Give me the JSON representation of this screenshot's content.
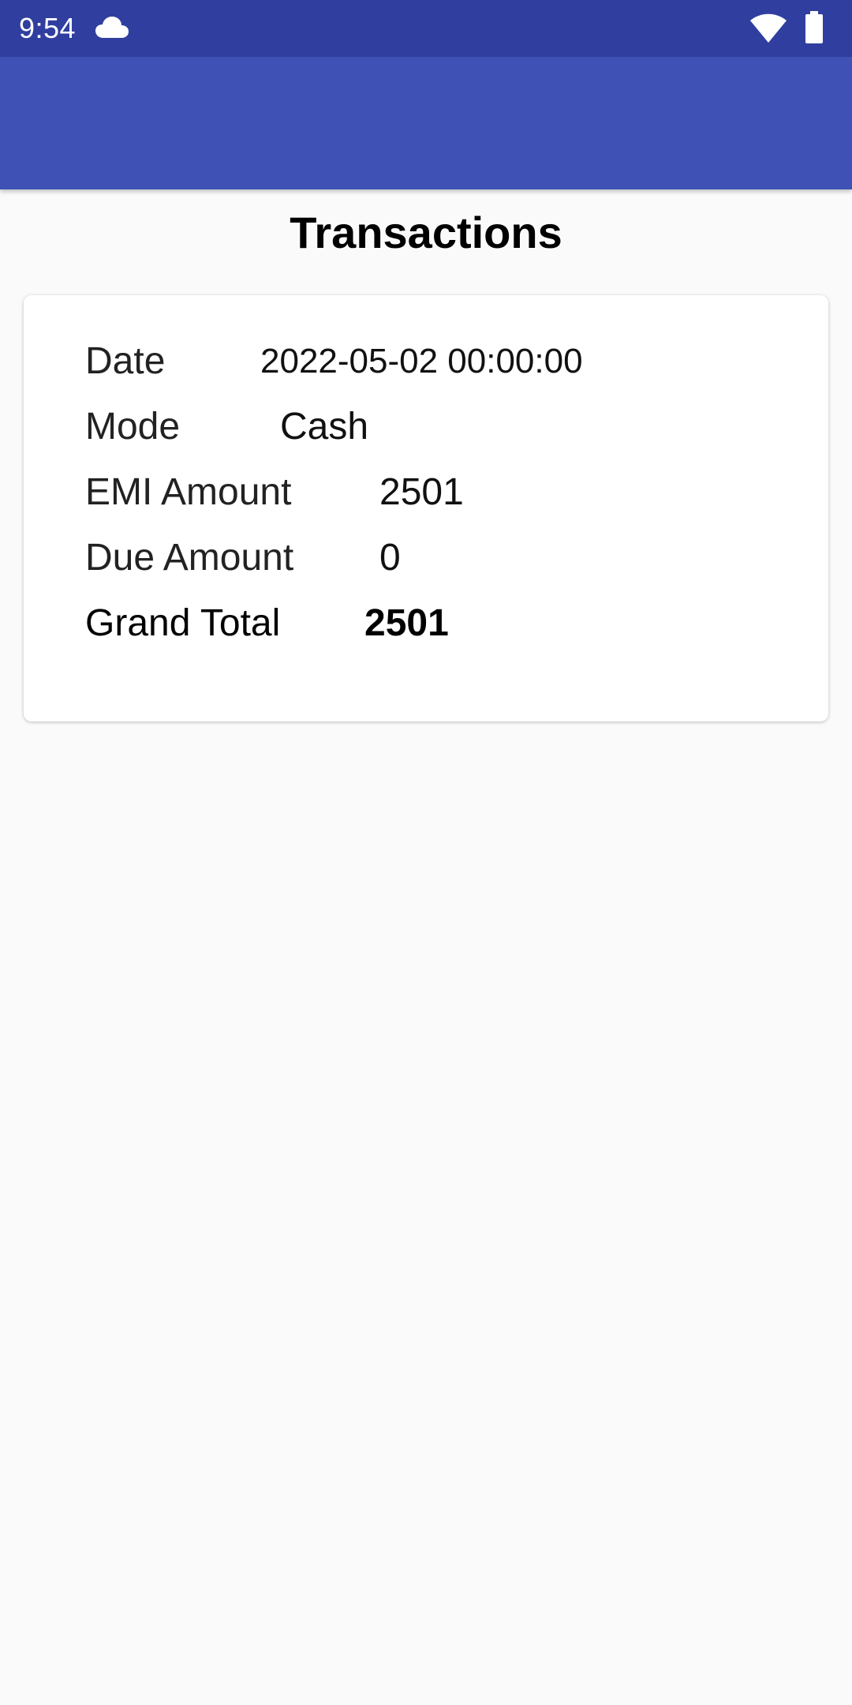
{
  "status_bar": {
    "time": "9:54",
    "icons": [
      "cloud-icon",
      "wifi-icon",
      "battery-icon"
    ],
    "background": "#303f9f"
  },
  "app_bar": {
    "background": "#3f51b5"
  },
  "page": {
    "title": "Transactions"
  },
  "transaction": {
    "date_label": "Date",
    "date_value": "2022-05-02 00:00:00",
    "mode_label": "Mode",
    "mode_value": "Cash",
    "emi_label": "EMI Amount",
    "emi_value": "2501",
    "due_label": "Due Amount",
    "due_value": "0",
    "grand_total_label": "Grand Total",
    "grand_total_value": "2501"
  }
}
